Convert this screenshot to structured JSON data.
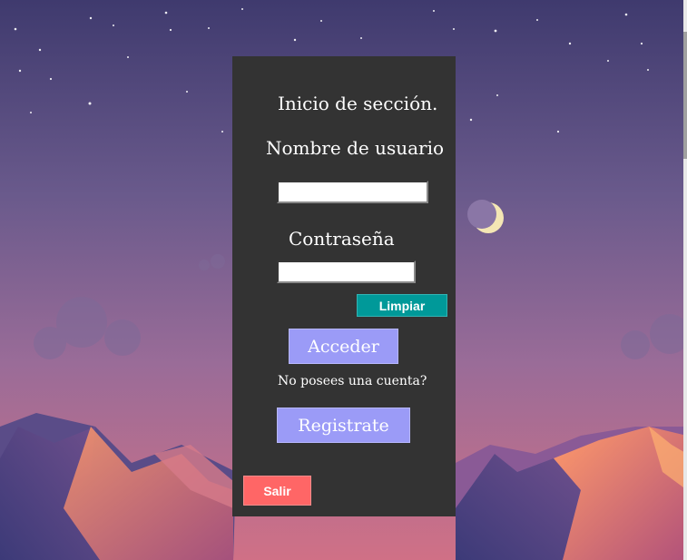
{
  "login": {
    "title": "Inicio de sección.",
    "username_label": "Nombre de usuario",
    "username_value": "",
    "password_label": "Contraseña",
    "password_value": "",
    "clear_button": "Limpiar",
    "login_button": "Acceder",
    "no_account_text": "No posees una cuenta?",
    "register_button": "Registrate",
    "exit_button": "Salir"
  },
  "colors": {
    "panel": "#333333",
    "primary_button": "#9b9bf7",
    "clear_button": "#009999",
    "exit_button": "#ff6666",
    "sky_top": "#3f3a6e",
    "sky_bottom": "#c96a86"
  },
  "background": {
    "description_icon": "night-desert-background"
  }
}
